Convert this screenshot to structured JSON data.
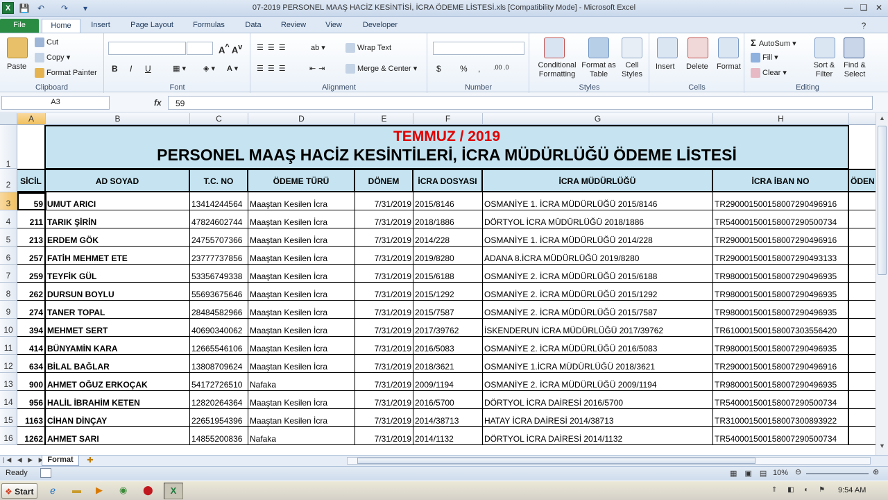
{
  "window": {
    "title": "07-2019 PERSONEL MAAŞ HACİZ KESİNTİSİ, İCRA ÖDEME LİSTESİ.xls  [Compatibility Mode]  -  Microsoft Excel",
    "app_icon_letter": "X"
  },
  "tabs": [
    "File",
    "Home",
    "Insert",
    "Page Layout",
    "Formulas",
    "Data",
    "Review",
    "View",
    "Developer"
  ],
  "ribbon": {
    "clipboard": {
      "paste": "Paste",
      "cut": "Cut",
      "copy": "Copy",
      "format_painter": "Format Painter",
      "label": "Clipboard"
    },
    "font": {
      "bold": "B",
      "italic": "I",
      "underline": "U",
      "label": "Font"
    },
    "alignment": {
      "wrap_text": "Wrap Text",
      "merge_center": "Merge & Center",
      "label": "Alignment"
    },
    "number": {
      "currency": "$",
      "percent": "%",
      "comma": ",",
      "label": "Number"
    },
    "styles": {
      "conditional": "Conditional Formatting",
      "format_table": "Format as Table",
      "cell_styles": "Cell Styles",
      "label": "Styles"
    },
    "cells": {
      "insert": "Insert",
      "delete": "Delete",
      "format": "Format",
      "label": "Cells"
    },
    "editing": {
      "autosum": "AutoSum",
      "fill": "Fill",
      "clear": "Clear",
      "sort_filter": "Sort & Filter",
      "find_select": "Find & Select",
      "label": "Editing"
    }
  },
  "formula_bar": {
    "name_box": "A3",
    "fx": "fx",
    "value": "59"
  },
  "columns": [
    "A",
    "B",
    "C",
    "D",
    "E",
    "F",
    "G",
    "H"
  ],
  "sheet": {
    "title_line1": "TEMMUZ / 2019",
    "title_line2": "PERSONEL MAAŞ HACİZ KESİNTİLERİ, İCRA MÜDÜRLÜĞÜ ÖDEME LİSTESİ",
    "headers": [
      "SİCİL",
      "AD SOYAD",
      "T.C. NO",
      "ÖDEME TÜRÜ",
      "DÖNEM",
      "İCRA DOSYASI",
      "İCRA MÜDÜRLÜĞÜ",
      "İCRA İBAN NO",
      "ÖDEN"
    ],
    "rows": [
      {
        "num": "3",
        "sicil": "59",
        "ad": "UMUT ARICI",
        "tc": "13414244564",
        "tur": "Maaştan Kesilen İcra",
        "donem": "7/31/2019",
        "dosya": "2015/8146",
        "mudurluk": "OSMANİYE 1. İCRA MÜDÜRLÜĞÜ 2015/8146",
        "iban": "TR290001500158007290496916"
      },
      {
        "num": "4",
        "sicil": "211",
        "ad": "TARIK ŞİRİN",
        "tc": "47824602744",
        "tur": "Maaştan Kesilen İcra",
        "donem": "7/31/2019",
        "dosya": "2018/1886",
        "mudurluk": "DÖRTYOL İCRA MÜDÜRLÜĞÜ 2018/1886",
        "iban": "TR540001500158007290500734"
      },
      {
        "num": "5",
        "sicil": "213",
        "ad": "ERDEM GÖK",
        "tc": "24755707366",
        "tur": "Maaştan Kesilen İcra",
        "donem": "7/31/2019",
        "dosya": "2014/228",
        "mudurluk": "OSMANİYE 1. İCRA MÜDÜRLÜĞÜ 2014/228",
        "iban": "TR290001500158007290496916"
      },
      {
        "num": "6",
        "sicil": "257",
        "ad": "FATİH MEHMET ETE",
        "tc": "23777737856",
        "tur": "Maaştan Kesilen İcra",
        "donem": "7/31/2019",
        "dosya": "2019/8280",
        "mudurluk": "ADANA 8.İCRA MÜDÜRLÜĞÜ 2019/8280",
        "iban": "TR290001500158007290493133"
      },
      {
        "num": "7",
        "sicil": "259",
        "ad": "TEYFİK GÜL",
        "tc": "53356749338",
        "tur": "Maaştan Kesilen İcra",
        "donem": "7/31/2019",
        "dosya": "2015/6188",
        "mudurluk": "OSMANİYE 2. İCRA MÜDÜRLÜĞÜ 2015/6188",
        "iban": "TR980001500158007290496935"
      },
      {
        "num": "8",
        "sicil": "262",
        "ad": "DURSUN BOYLU",
        "tc": "55693675646",
        "tur": "Maaştan Kesilen İcra",
        "donem": "7/31/2019",
        "dosya": "2015/1292",
        "mudurluk": "OSMANİYE 2. İCRA MÜDÜRLÜĞÜ 2015/1292",
        "iban": "TR980001500158007290496935"
      },
      {
        "num": "9",
        "sicil": "274",
        "ad": "TANER TOPAL",
        "tc": "28484582966",
        "tur": "Maaştan Kesilen İcra",
        "donem": "7/31/2019",
        "dosya": "2015/7587",
        "mudurluk": "OSMANİYE 2. İCRA MÜDÜRLÜĞÜ 2015/7587",
        "iban": "TR980001500158007290496935"
      },
      {
        "num": "10",
        "sicil": "394",
        "ad": "MEHMET SERT",
        "tc": "40690340062",
        "tur": "Maaştan Kesilen İcra",
        "donem": "7/31/2019",
        "dosya": "2017/39762",
        "mudurluk": "İSKENDERUN İCRA MÜDÜRLÜĞÜ 2017/39762",
        "iban": "TR610001500158007303556420"
      },
      {
        "num": "11",
        "sicil": "414",
        "ad": "BÜNYAMİN KARA",
        "tc": "12665546106",
        "tur": "Maaştan Kesilen İcra",
        "donem": "7/31/2019",
        "dosya": "2016/5083",
        "mudurluk": "OSMANİYE 2. İCRA MÜDÜRLÜĞÜ 2016/5083",
        "iban": "TR980001500158007290496935"
      },
      {
        "num": "12",
        "sicil": "634",
        "ad": "BİLAL BAĞLAR",
        "tc": "13808709624",
        "tur": "Maaştan Kesilen İcra",
        "donem": "7/31/2019",
        "dosya": "2018/3621",
        "mudurluk": "OSMANİYE 1.İCRA MÜDÜRLÜĞÜ 2018/3621",
        "iban": "TR290001500158007290496916"
      },
      {
        "num": "13",
        "sicil": "900",
        "ad": "AHMET OĞUZ ERKOÇAK",
        "tc": "54172726510",
        "tur": "Nafaka",
        "donem": "7/31/2019",
        "dosya": "2009/1194",
        "mudurluk": "OSMANİYE 2. İCRA MÜDÜRLÜĞÜ 2009/1194",
        "iban": "TR980001500158007290496935"
      },
      {
        "num": "14",
        "sicil": "956",
        "ad": "HALİL İBRAHİM KETEN",
        "tc": "12820264364",
        "tur": "Maaştan Kesilen İcra",
        "donem": "7/31/2019",
        "dosya": "2016/5700",
        "mudurluk": "DÖRTYOL İCRA DAİRESİ 2016/5700",
        "iban": "TR540001500158007290500734"
      },
      {
        "num": "15",
        "sicil": "1163",
        "ad": "CİHAN DİNÇAY",
        "tc": "22651954396",
        "tur": "Maaştan Kesilen İcra",
        "donem": "7/31/2019",
        "dosya": "2014/38713",
        "mudurluk": "HATAY İCRA DAİRESİ 2014/38713",
        "iban": "TR310001500158007300893922"
      },
      {
        "num": "16",
        "sicil": "1262",
        "ad": "AHMET SARI",
        "tc": "14855200836",
        "tur": "Nafaka",
        "donem": "7/31/2019",
        "dosya": "2014/1132",
        "mudurluk": "DÖRTYOL İCRA DAİRESİ 2014/1132",
        "iban": "TR540001500158007290500734"
      }
    ]
  },
  "sheet_tabs": [
    "Format"
  ],
  "status": {
    "ready": "Ready",
    "zoom": "10%"
  },
  "taskbar": {
    "start": "Start",
    "clock": "9:54 AM"
  },
  "colors": {
    "title_red": "#e00000",
    "header_fill": "#c5e3f0",
    "file_tab": "#2a8c43"
  }
}
